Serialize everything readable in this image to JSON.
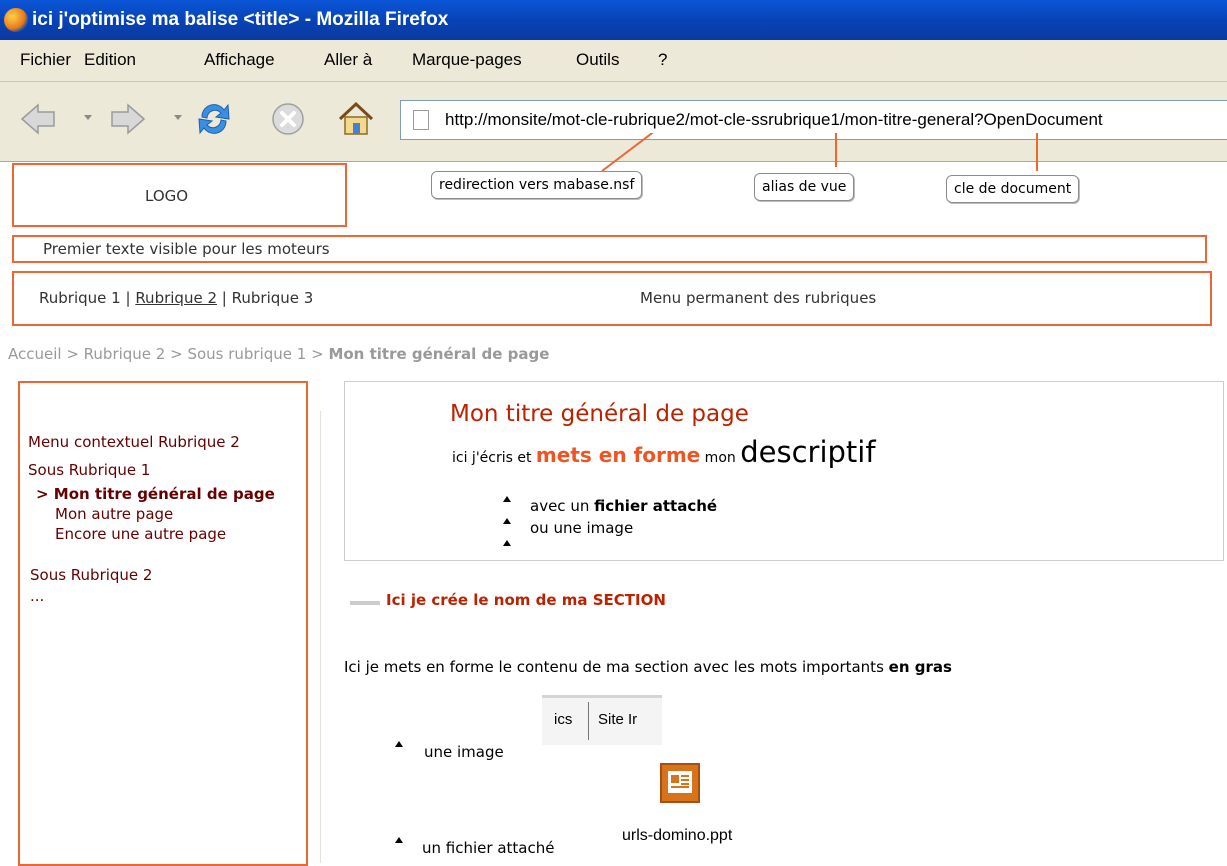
{
  "window": {
    "title": "ici j'optimise ma balise <title> - Mozilla Firefox"
  },
  "menubar": {
    "items": [
      "Fichier",
      "Edition",
      "Affichage",
      "Aller à",
      "Marque-pages",
      "Outils",
      "?"
    ]
  },
  "toolbar": {
    "back_icon": "back-arrow-icon",
    "forward_icon": "forward-arrow-icon",
    "reload_icon": "reload-icon",
    "stop_icon": "stop-icon",
    "home_icon": "home-icon",
    "url": "http://monsite/mot-cle-rubrique2/mot-cle-ssrubrique1/mon-titre-general?OpenDocument"
  },
  "annotations": {
    "redirect": "redirection vers mabase.nsf",
    "alias": "alias de vue",
    "doc_key": "cle de document",
    "logo": "LOGO",
    "seo_first_text": "Premier texte visible pour les moteurs",
    "menu_caption": "Menu permanent des rubriques"
  },
  "rubriques": {
    "r1": "Rubrique 1",
    "sep": "|",
    "r2": "Rubrique 2",
    "r3": "Rubrique 3"
  },
  "breadcrumb": {
    "text": "Accueil > Rubrique 2 > Sous rubrique 1 > ",
    "current": "Mon titre général de page"
  },
  "sidebar": {
    "title": "Menu contextuel Rubrique 2",
    "sub1": "Sous Rubrique 1",
    "current": "> Mon titre général de page",
    "page2": "Mon autre page",
    "page3": "Encore une autre page",
    "sub2": "Sous Rubrique 2",
    "more": "..."
  },
  "main": {
    "title": "Mon titre général de page",
    "desc_part1": "ici j'écris et ",
    "desc_bold": "mets en forme",
    "desc_part2": " mon ",
    "desc_big": "descriptif",
    "bullet1_text": "avec un ",
    "bullet1_bold": "fichier attaché",
    "bullet2": "ou une image",
    "section_title": "Ici je crée le nom de ma SECTION",
    "paragraph": "Ici je mets en forme le contenu de ma section avec les mots importants ",
    "paragraph_bold": "en gras",
    "item_image": "une image",
    "image_crop_left": "ics",
    "image_crop_right": "Site Ir",
    "item_file": "un fichier attaché",
    "file_name": "urls-domino.ppt",
    "file_icon": "powerpoint-file-icon"
  },
  "colors": {
    "annotation": "#ee6633",
    "title_red": "#bb2200",
    "dark_red": "#660000",
    "link": "#660000",
    "breadcrumb_grey": "#999999"
  }
}
